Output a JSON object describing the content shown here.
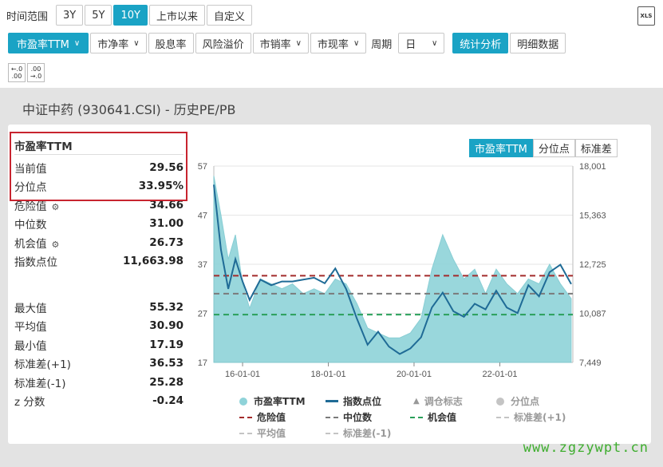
{
  "toolbar1": {
    "range_label": "时间范围",
    "ranges": [
      "3Y",
      "5Y",
      "10Y",
      "上市以来",
      "自定义"
    ],
    "active_range": "10Y"
  },
  "toolbar2": {
    "metrics": [
      "市盈率TTM",
      "市净率",
      "股息率",
      "风险溢价",
      "市销率",
      "市现率"
    ],
    "period_label": "周期",
    "period_value": "日",
    "views": [
      "统计分析",
      "明细数据"
    ]
  },
  "xls_label": "XLS",
  "decimal_buttons": [
    "←.0 .00",
    ".00 →.0"
  ],
  "panel_title": "中证中药 (930641.CSI) - 历史PE/PB",
  "stats": {
    "title": "市盈率TTM",
    "current_label": "当前值",
    "current_value": "29.56",
    "pct_label": "分位点",
    "pct_value": "33.95%",
    "danger_label": "危险值",
    "danger_value": "34.66",
    "median_label": "中位数",
    "median_value": "31.00",
    "chance_label": "机会值",
    "chance_value": "26.73",
    "index_label": "指数点位",
    "index_value": "11,663.98",
    "max_label": "最大值",
    "max_value": "55.32",
    "avg_label": "平均值",
    "avg_value": "30.90",
    "min_label": "最小值",
    "min_value": "17.19",
    "sdp_label": "标准差(+1)",
    "sdp_value": "36.53",
    "sdm_label": "标准差(-1)",
    "sdm_value": "25.28",
    "z_label": "z 分数",
    "z_value": "-0.24"
  },
  "chart_tabs": [
    "市盈率TTM",
    "分位点",
    "标准差"
  ],
  "legend": {
    "pe": "市盈率TTM",
    "index": "指数点位",
    "adjust": "调仓标志",
    "pct": "分位点",
    "danger": "危险值",
    "median": "中位数",
    "chance": "机会值",
    "sdp": "标准差(+1)",
    "avg": "平均值",
    "sdm": "标准差(-1)"
  },
  "watermark": "www.zgzywpt.cn",
  "colors": {
    "accent": "#1aa3c5",
    "area": "#8fd3d9",
    "line": "#1f6b96",
    "danger": "#a32b2b",
    "median": "#7a7a7a",
    "chance": "#2aa05a"
  },
  "chart_data": {
    "type": "area",
    "left_axis": {
      "ticks": [
        57,
        47,
        37,
        27,
        17
      ],
      "range": [
        17,
        57
      ]
    },
    "right_axis": {
      "ticks": [
        "18,001",
        "15,363",
        "12,725",
        "10,087",
        "7,449"
      ],
      "range": [
        7449,
        18001
      ]
    },
    "x_ticks": [
      "16-01-01",
      "18-01-01",
      "20-01-01",
      "22-01-01"
    ],
    "ref_lines": {
      "danger": 34.66,
      "median": 31.0,
      "chance": 26.73
    },
    "series": [
      {
        "name": "市盈率TTM",
        "x": [
          "2015-05",
          "2015-07",
          "2015-09",
          "2015-11",
          "2016-01",
          "2016-03",
          "2016-06",
          "2016-09",
          "2016-12",
          "2017-03",
          "2017-06",
          "2017-09",
          "2017-12",
          "2018-03",
          "2018-06",
          "2018-09",
          "2018-12",
          "2019-03",
          "2019-06",
          "2019-09",
          "2019-12",
          "2020-03",
          "2020-06",
          "2020-09",
          "2020-12",
          "2021-03",
          "2021-06",
          "2021-09",
          "2021-12",
          "2022-03",
          "2022-06",
          "2022-09",
          "2022-12",
          "2023-03",
          "2023-06",
          "2023-09"
        ],
        "values": [
          55,
          47,
          38,
          43,
          33,
          28,
          34,
          33,
          32,
          33,
          31,
          32,
          31,
          34,
          33,
          29,
          24,
          23,
          22,
          22,
          23,
          26,
          36,
          43,
          38,
          34,
          36,
          31,
          36,
          33,
          31,
          34,
          33,
          37,
          33,
          30
        ]
      },
      {
        "name": "指数点位",
        "x": [
          "2015-05",
          "2015-07",
          "2015-09",
          "2015-11",
          "2016-01",
          "2016-03",
          "2016-06",
          "2016-09",
          "2016-12",
          "2017-03",
          "2017-06",
          "2017-09",
          "2017-12",
          "2018-03",
          "2018-06",
          "2018-09",
          "2018-12",
          "2019-03",
          "2019-06",
          "2019-09",
          "2019-12",
          "2020-03",
          "2020-06",
          "2020-09",
          "2020-12",
          "2021-03",
          "2021-06",
          "2021-09",
          "2021-12",
          "2022-03",
          "2022-06",
          "2022-09",
          "2022-12",
          "2023-03",
          "2023-06",
          "2023-09"
        ],
        "values": [
          17000,
          13500,
          11400,
          13000,
          11800,
          10800,
          11900,
          11600,
          11800,
          11800,
          11900,
          12000,
          11700,
          12500,
          11400,
          9800,
          8400,
          9100,
          8300,
          7900,
          8200,
          8800,
          10400,
          11200,
          10200,
          9900,
          10600,
          10300,
          11300,
          10400,
          10100,
          11600,
          11000,
          12300,
          12700,
          11660
        ]
      }
    ]
  }
}
